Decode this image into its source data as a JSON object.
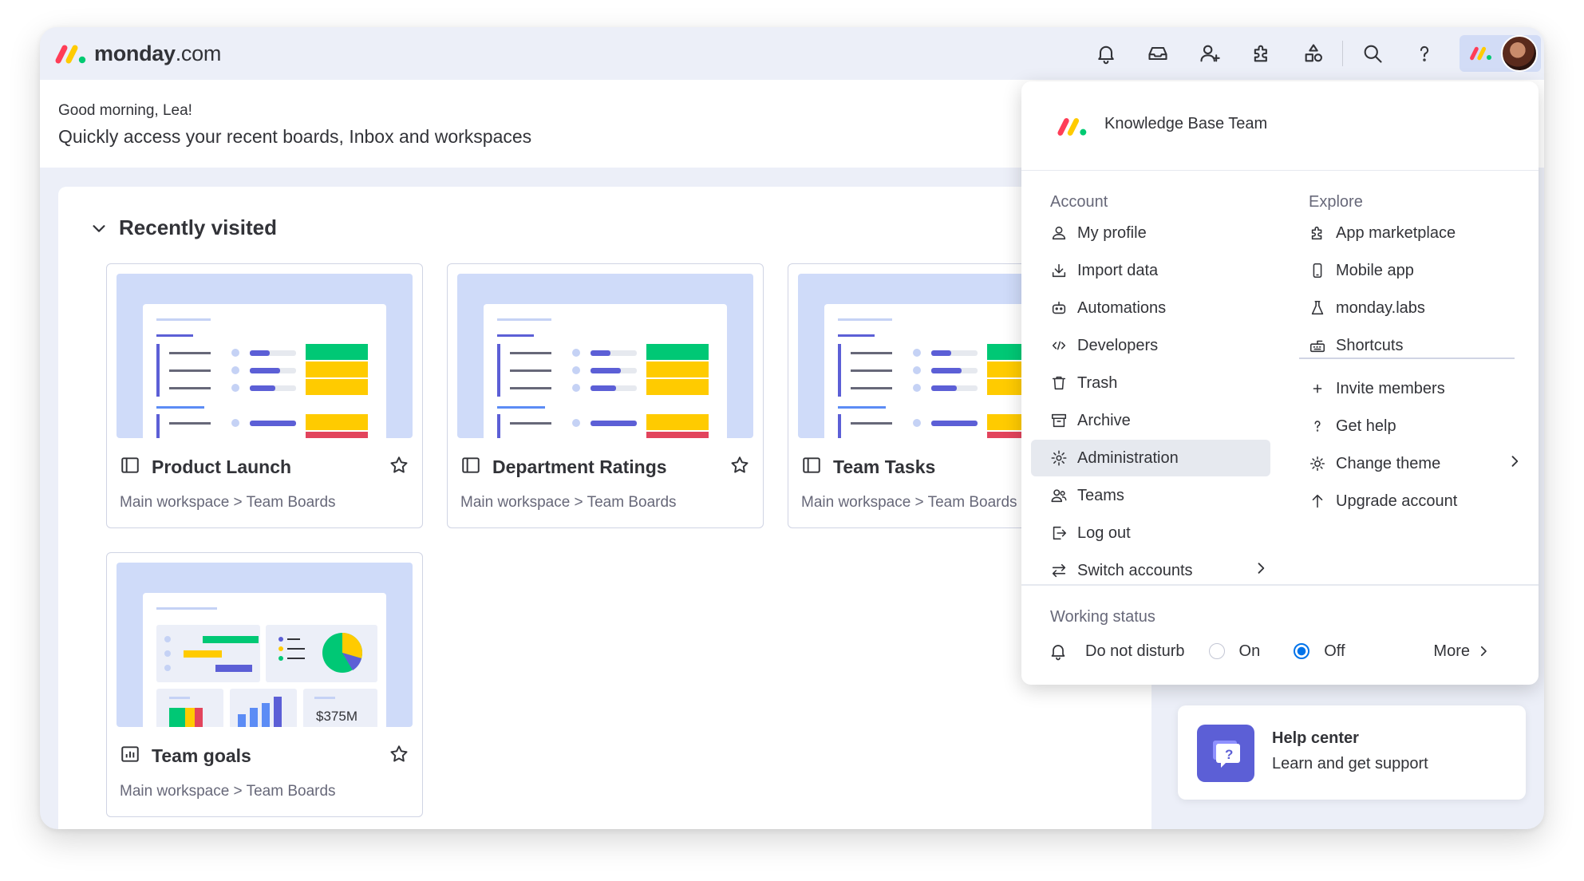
{
  "app": {
    "logo_bold": "monday",
    "logo_light": ".com"
  },
  "greeting": {
    "hello": "Good morning, Lea!",
    "subtitle": "Quickly access your recent boards, Inbox and workspaces"
  },
  "recent": {
    "title": "Recently visited",
    "cards": [
      {
        "title": "Product Launch",
        "path": "Main workspace > Team Boards"
      },
      {
        "title": "Department Ratings",
        "path": "Main workspace > Team Boards"
      },
      {
        "title": "Team Tasks",
        "path": "Main workspace > Team Boards"
      },
      {
        "title": "Team goals",
        "path": "Main workspace > Team Boards",
        "thumb_value": "$375M"
      }
    ]
  },
  "help": {
    "title": "Help center",
    "subtitle": "Learn and get support"
  },
  "menu": {
    "team": "Knowledge Base Team",
    "account_title": "Account",
    "explore_title": "Explore",
    "account_items": [
      {
        "label": "My profile",
        "icon": "person-icon"
      },
      {
        "label": "Import data",
        "icon": "download-icon"
      },
      {
        "label": "Automations",
        "icon": "robot-icon"
      },
      {
        "label": "Developers",
        "icon": "code-icon"
      },
      {
        "label": "Trash",
        "icon": "trash-icon"
      },
      {
        "label": "Archive",
        "icon": "archive-icon"
      },
      {
        "label": "Administration",
        "icon": "gear-icon"
      },
      {
        "label": "Teams",
        "icon": "team-icon"
      },
      {
        "label": "Log out",
        "icon": "logout-icon"
      },
      {
        "label": "Switch accounts",
        "icon": "switch-icon"
      }
    ],
    "explore_items": [
      {
        "label": "App marketplace",
        "icon": "puzzle-icon"
      },
      {
        "label": "Mobile app",
        "icon": "mobile-icon"
      },
      {
        "label": "monday.labs",
        "icon": "flask-icon"
      },
      {
        "label": "Shortcuts",
        "icon": "keyboard-icon"
      },
      {
        "label": "Invite members",
        "icon": "plus-icon"
      },
      {
        "label": "Get help",
        "icon": "question-icon"
      },
      {
        "label": "Change theme",
        "icon": "sun-icon"
      },
      {
        "label": "Upgrade account",
        "icon": "arrow-up-icon"
      }
    ],
    "working_status": {
      "title": "Working status",
      "dnd_label": "Do not disturb",
      "on_label": "On",
      "off_label": "Off",
      "selected": "Off",
      "more_label": "More"
    }
  },
  "colors": {
    "accent": "#0073ea",
    "green": "#00c875",
    "yellow": "#ffcb00",
    "red": "#e2445c",
    "purple": "#5c5fd6",
    "thumb_bg": "#cfdbf9"
  }
}
